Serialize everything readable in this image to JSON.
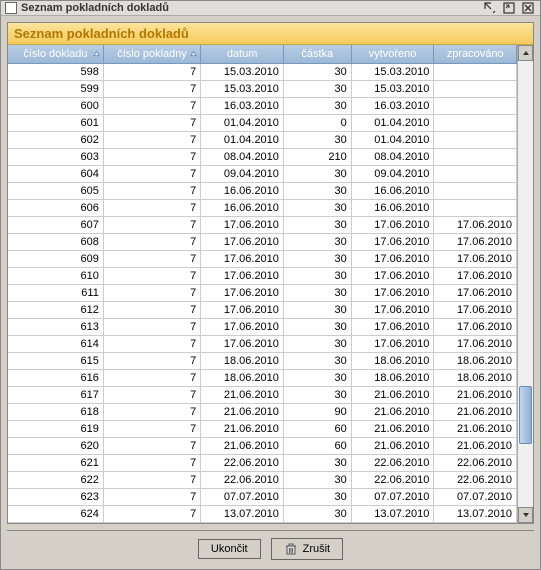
{
  "window": {
    "title": "Seznam pokladních dokladů"
  },
  "panel": {
    "title": "Seznam pokladních dokladů"
  },
  "columns": {
    "doc_no": "číslo dokladu",
    "cash_no": "číslo pokladny",
    "date": "datum",
    "amount": "částka",
    "created": "vytvořeno",
    "processed": "zpracováno"
  },
  "rows": [
    {
      "doc_no": "598",
      "cash_no": "7",
      "date": "15.03.2010",
      "amount": "30",
      "created": "15.03.2010",
      "processed": ""
    },
    {
      "doc_no": "599",
      "cash_no": "7",
      "date": "15.03.2010",
      "amount": "30",
      "created": "15.03.2010",
      "processed": ""
    },
    {
      "doc_no": "600",
      "cash_no": "7",
      "date": "16.03.2010",
      "amount": "30",
      "created": "16.03.2010",
      "processed": ""
    },
    {
      "doc_no": "601",
      "cash_no": "7",
      "date": "01.04.2010",
      "amount": "0",
      "created": "01.04.2010",
      "processed": ""
    },
    {
      "doc_no": "602",
      "cash_no": "7",
      "date": "01.04.2010",
      "amount": "30",
      "created": "01.04.2010",
      "processed": ""
    },
    {
      "doc_no": "603",
      "cash_no": "7",
      "date": "08.04.2010",
      "amount": "210",
      "created": "08.04.2010",
      "processed": ""
    },
    {
      "doc_no": "604",
      "cash_no": "7",
      "date": "09.04.2010",
      "amount": "30",
      "created": "09.04.2010",
      "processed": ""
    },
    {
      "doc_no": "605",
      "cash_no": "7",
      "date": "16.06.2010",
      "amount": "30",
      "created": "16.06.2010",
      "processed": ""
    },
    {
      "doc_no": "606",
      "cash_no": "7",
      "date": "16.06.2010",
      "amount": "30",
      "created": "16.06.2010",
      "processed": ""
    },
    {
      "doc_no": "607",
      "cash_no": "7",
      "date": "17.06.2010",
      "amount": "30",
      "created": "17.06.2010",
      "processed": "17.06.2010"
    },
    {
      "doc_no": "608",
      "cash_no": "7",
      "date": "17.06.2010",
      "amount": "30",
      "created": "17.06.2010",
      "processed": "17.06.2010"
    },
    {
      "doc_no": "609",
      "cash_no": "7",
      "date": "17.06.2010",
      "amount": "30",
      "created": "17.06.2010",
      "processed": "17.06.2010"
    },
    {
      "doc_no": "610",
      "cash_no": "7",
      "date": "17.06.2010",
      "amount": "30",
      "created": "17.06.2010",
      "processed": "17.06.2010"
    },
    {
      "doc_no": "611",
      "cash_no": "7",
      "date": "17.06.2010",
      "amount": "30",
      "created": "17.06.2010",
      "processed": "17.06.2010"
    },
    {
      "doc_no": "612",
      "cash_no": "7",
      "date": "17.06.2010",
      "amount": "30",
      "created": "17.06.2010",
      "processed": "17.06.2010"
    },
    {
      "doc_no": "613",
      "cash_no": "7",
      "date": "17.06.2010",
      "amount": "30",
      "created": "17.06.2010",
      "processed": "17.06.2010"
    },
    {
      "doc_no": "614",
      "cash_no": "7",
      "date": "17.06.2010",
      "amount": "30",
      "created": "17.06.2010",
      "processed": "17.06.2010"
    },
    {
      "doc_no": "615",
      "cash_no": "7",
      "date": "18.06.2010",
      "amount": "30",
      "created": "18.06.2010",
      "processed": "18.06.2010"
    },
    {
      "doc_no": "616",
      "cash_no": "7",
      "date": "18.06.2010",
      "amount": "30",
      "created": "18.06.2010",
      "processed": "18.06.2010"
    },
    {
      "doc_no": "617",
      "cash_no": "7",
      "date": "21.06.2010",
      "amount": "30",
      "created": "21.06.2010",
      "processed": "21.06.2010"
    },
    {
      "doc_no": "618",
      "cash_no": "7",
      "date": "21.06.2010",
      "amount": "90",
      "created": "21.06.2010",
      "processed": "21.06.2010"
    },
    {
      "doc_no": "619",
      "cash_no": "7",
      "date": "21.06.2010",
      "amount": "60",
      "created": "21.06.2010",
      "processed": "21.06.2010"
    },
    {
      "doc_no": "620",
      "cash_no": "7",
      "date": "21.06.2010",
      "amount": "60",
      "created": "21.06.2010",
      "processed": "21.06.2010"
    },
    {
      "doc_no": "621",
      "cash_no": "7",
      "date": "22.06.2010",
      "amount": "30",
      "created": "22.06.2010",
      "processed": "22.06.2010"
    },
    {
      "doc_no": "622",
      "cash_no": "7",
      "date": "22.06.2010",
      "amount": "30",
      "created": "22.06.2010",
      "processed": "22.06.2010"
    },
    {
      "doc_no": "623",
      "cash_no": "7",
      "date": "07.07.2010",
      "amount": "30",
      "created": "07.07.2010",
      "processed": "07.07.2010"
    },
    {
      "doc_no": "624",
      "cash_no": "7",
      "date": "13.07.2010",
      "amount": "30",
      "created": "13.07.2010",
      "processed": "13.07.2010"
    }
  ],
  "buttons": {
    "close": "Ukončit",
    "cancel": "Zrušit"
  }
}
